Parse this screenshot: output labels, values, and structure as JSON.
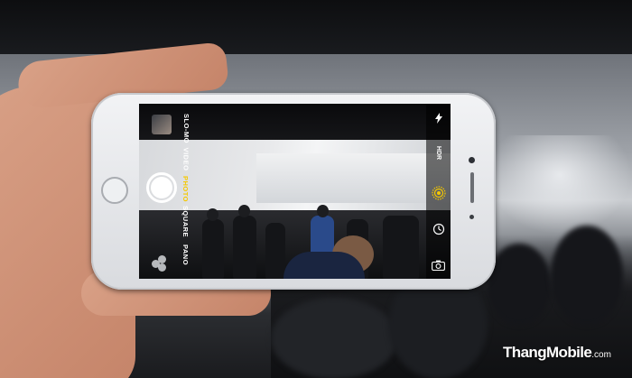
{
  "camera": {
    "modes": [
      "SLO-MO",
      "VIDEO",
      "PHOTO",
      "SQUARE",
      "PANO"
    ],
    "active_mode": "PHOTO",
    "hdr_label": "HDR",
    "icons": {
      "flash": "flash-icon",
      "live": "live-photo-icon",
      "timer": "timer-icon",
      "switch": "camera-switch-icon",
      "filters": "filters-icon",
      "shutter": "shutter-button"
    }
  },
  "watermark": {
    "brand": "ThangMobile",
    "suffix": ".com"
  },
  "colors": {
    "active_mode": "#f5c800",
    "live_icon": "#f5c800"
  }
}
